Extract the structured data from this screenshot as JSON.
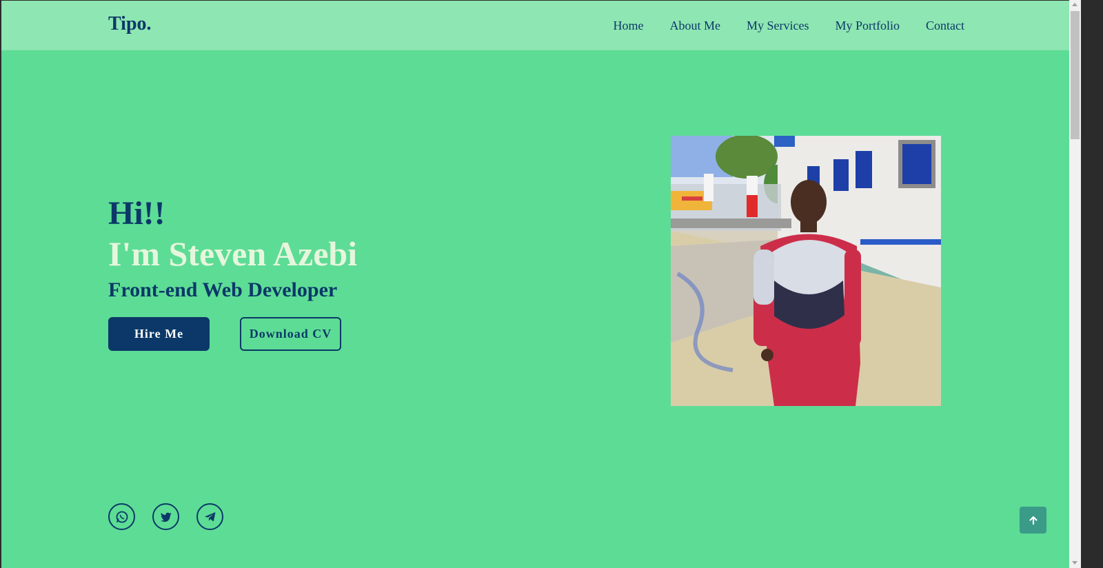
{
  "colors": {
    "page_background": "#5ddc95",
    "navbar_background": "#8ee6b2",
    "primary": "#0b3868",
    "name_text": "#e6f6dd",
    "back_to_top": "#3a9b88"
  },
  "navbar": {
    "brand": "Tipo.",
    "links": [
      "Home",
      "About Me",
      "My Services",
      "My Portfolio",
      "Contact"
    ]
  },
  "hero": {
    "greeting": "Hi!!",
    "name": "I'm Steven Azebi",
    "role": "Front-end Web Developer",
    "hire_button": "Hire Me",
    "cv_button": "Download CV"
  },
  "socials": [
    "whatsapp-icon",
    "twitter-icon",
    "telegram-icon"
  ],
  "back_to_top_icon": "arrow-up-icon"
}
